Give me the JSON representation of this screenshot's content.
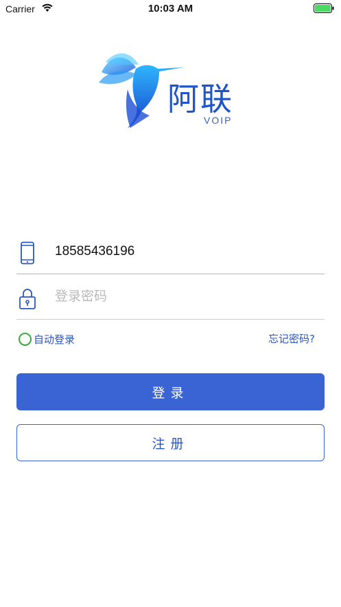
{
  "status_bar": {
    "carrier": "Carrier",
    "time": "10:03 AM",
    "wifi_icon": "wifi-icon",
    "battery_icon": "battery-icon",
    "battery_color": "#4cd964"
  },
  "logo": {
    "title": "阿联",
    "subtitle": "VOIP",
    "icon": "hummingbird-logo-icon",
    "brand_color": "#1e56c8"
  },
  "form": {
    "phone": {
      "icon": "phone-icon",
      "value": "18585436196"
    },
    "password": {
      "icon": "lock-icon",
      "value": "",
      "placeholder": "登录密码"
    },
    "auto_login": {
      "label": "自动登录",
      "checked": false
    },
    "forgot_password_label": "忘记密码?"
  },
  "buttons": {
    "login_label": "登录",
    "register_label": "注册",
    "accent_color": "#3a63d4"
  }
}
